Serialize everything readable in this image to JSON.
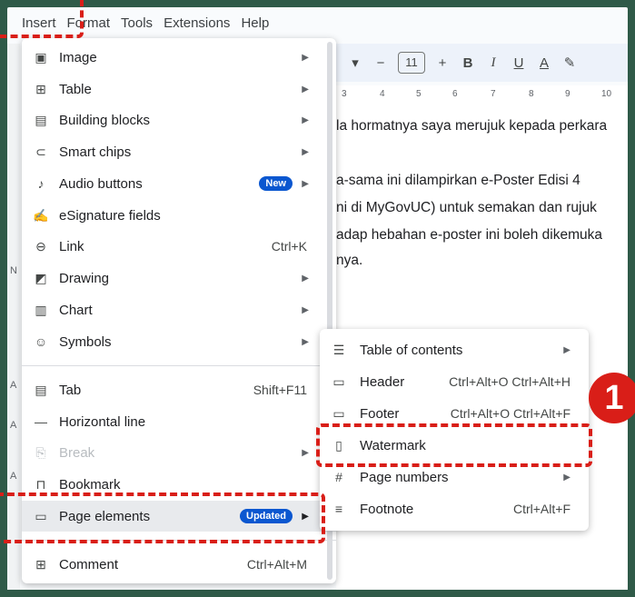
{
  "menubar": [
    "Insert",
    "Format",
    "Tools",
    "Extensions",
    "Help"
  ],
  "toolbar": {
    "dropdown": "▾",
    "minus": "−",
    "font_size": "11",
    "plus": "+",
    "bold": "B",
    "italic": "I",
    "underline": "U",
    "text_color": "A",
    "highlight": "✎"
  },
  "ruler": [
    "3",
    "4",
    "5",
    "6",
    "7",
    "8",
    "9",
    "10"
  ],
  "document_lines": [
    "la hormatnya saya merujuk kepada perkara",
    "a-sama ini dilampirkan e-Poster Edisi 4",
    "ni di MyGovUC) untuk semakan dan rujuk",
    "adap hebahan e-poster ini boleh dikemuka",
    "nya."
  ],
  "left_margin_letters": [
    "N",
    "A",
    "A",
    "A"
  ],
  "insert_menu": {
    "items": [
      {
        "label": "Image",
        "icon": "image-icon"
      },
      {
        "label": "Table",
        "icon": "table-icon"
      },
      {
        "label": "Building blocks",
        "icon": "building-blocks-icon"
      },
      {
        "label": "Smart chips",
        "icon": "smart-chips-icon"
      },
      {
        "label": "Audio buttons",
        "icon": "audio-icon",
        "badge": "New"
      },
      {
        "label": "eSignature fields",
        "icon": "signature-icon"
      },
      {
        "label": "Link",
        "icon": "link-icon",
        "shortcut": "Ctrl+K"
      },
      {
        "label": "Drawing",
        "icon": "drawing-icon"
      },
      {
        "label": "Chart",
        "icon": "chart-icon"
      },
      {
        "label": "Symbols",
        "icon": "symbols-icon"
      },
      {
        "label": "Tab",
        "icon": "tab-icon",
        "shortcut": "Shift+F11"
      },
      {
        "label": "Horizontal line",
        "icon": "horizontal-line-icon"
      },
      {
        "label": "Break",
        "icon": "break-icon"
      },
      {
        "label": "Bookmark",
        "icon": "bookmark-icon"
      },
      {
        "label": "Page elements",
        "icon": "page-elements-icon",
        "badge": "Updated"
      },
      {
        "label": "Comment",
        "icon": "comment-icon",
        "shortcut": "Ctrl+Alt+M"
      }
    ]
  },
  "page_elements_submenu": {
    "items": [
      {
        "label": "Table of contents",
        "icon": "toc-icon"
      },
      {
        "label": "Header",
        "icon": "header-icon",
        "shortcut": "Ctrl+Alt+O Ctrl+Alt+H"
      },
      {
        "label": "Footer",
        "icon": "footer-icon",
        "shortcut": "Ctrl+Alt+O Ctrl+Alt+F"
      },
      {
        "label": "Watermark",
        "icon": "watermark-icon"
      },
      {
        "label": "Page numbers",
        "icon": "page-numbers-icon"
      },
      {
        "label": "Footnote",
        "icon": "footnote-icon",
        "shortcut": "Ctrl+Alt+F"
      }
    ]
  },
  "step_badge": "1",
  "colors": {
    "highlight_dash": "#d91e18",
    "badge_blue": "#0b57d0",
    "background": "#2f5a48"
  }
}
